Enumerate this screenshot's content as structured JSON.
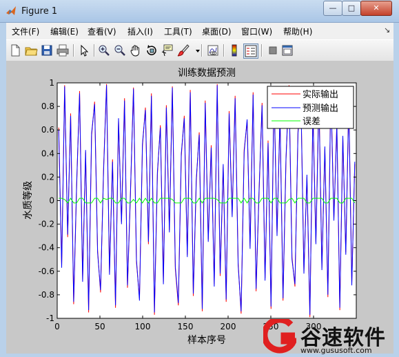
{
  "window": {
    "title": "Figure 1",
    "min_label": "—",
    "max_label": "□",
    "close_label": "✕"
  },
  "menu": [
    "文件(F)",
    "编辑(E)",
    "查看(V)",
    "插入(I)",
    "工具(T)",
    "桌面(D)",
    "窗口(W)",
    "帮助(H)"
  ],
  "menu_overflow_label": "↘",
  "toolbar_icons": [
    "new-figure-icon",
    "open-file-icon",
    "save-icon",
    "print-icon",
    "select-arrow-icon",
    "zoom-in-icon",
    "zoom-out-icon",
    "pan-hand-icon",
    "rotate-3d-icon",
    "data-cursor-icon",
    "brush-icon",
    "brush-dropdown-icon",
    "link-plot-icon",
    "insert-colorbar-icon",
    "insert-legend-icon",
    "hide-plot-tools-icon",
    "show-plot-tools-icon"
  ],
  "colors": {
    "actual": "#ff0000",
    "predicted": "#0000ff",
    "error": "#00ff00",
    "figure_bg": "#c8c8c8",
    "axes_bg": "#ffffff"
  },
  "chart_data": {
    "type": "line",
    "title": "训练数据预测",
    "xlabel": "样本序号",
    "ylabel": "水质等级",
    "xlim": [
      0,
      350
    ],
    "ylim": [
      -1,
      1
    ],
    "xticks": [
      "0",
      "50",
      "100",
      "150",
      "200",
      "250",
      "300"
    ],
    "yticks": [
      "-1",
      "-0.8",
      "-0.6",
      "-0.4",
      "-0.2",
      "0",
      "0.2",
      "0.4",
      "0.6",
      "0.8",
      "1"
    ],
    "legend_position": "top-right",
    "series": [
      {
        "name": "实际输出",
        "color": "#ff0000",
        "values": [
          0.62,
          -0.55,
          0.98,
          -0.31,
          0.74,
          -0.88,
          0.12,
          0.93,
          -0.67,
          0.41,
          -0.95,
          0.55,
          0.84,
          -0.42,
          -0.78,
          0.27,
          0.99,
          -0.61,
          0.35,
          -0.91,
          0.68,
          -0.18,
          0.87,
          -0.74,
          0.05,
          0.96,
          -0.52,
          -0.83,
          0.46,
          0.79,
          -0.37,
          0.91,
          -0.97,
          0.22,
          0.64,
          -0.69,
          0.81,
          -0.25,
          0.97,
          -0.58,
          -0.89,
          0.38,
          0.72,
          -0.46,
          0.94,
          -0.81,
          0.16,
          0.58,
          -0.94,
          0.85,
          -0.33,
          0.47,
          -0.71,
          0.99,
          -0.64,
          0.29,
          -0.86,
          0.76,
          -0.12,
          0.89,
          -0.53,
          -0.96,
          0.43,
          0.67,
          -0.39,
          0.92,
          -0.77,
          0.08,
          0.83,
          -0.66,
          0.51,
          -0.92,
          0.95,
          -0.28,
          0.71,
          -0.85,
          0.34,
          0.98,
          -0.48,
          -0.73,
          0.59,
          0.88,
          -0.6,
          0.2,
          -0.99,
          0.77,
          -0.35,
          0.9,
          -0.57,
          0.44,
          -0.82,
          0.97,
          -0.15,
          0.66,
          -0.93,
          0.53,
          -0.44,
          0.86,
          -0.7,
          0.31
        ]
      },
      {
        "name": "预测输出",
        "color": "#0000ff",
        "values": [
          0.6,
          -0.57,
          0.97,
          -0.29,
          0.72,
          -0.86,
          0.14,
          0.91,
          -0.69,
          0.43,
          -0.93,
          0.57,
          0.82,
          -0.44,
          -0.76,
          0.25,
          0.98,
          -0.63,
          0.33,
          -0.89,
          0.7,
          -0.2,
          0.85,
          -0.72,
          0.07,
          0.95,
          -0.5,
          -0.85,
          0.48,
          0.77,
          -0.35,
          0.89,
          -0.95,
          0.24,
          0.62,
          -0.71,
          0.79,
          -0.27,
          0.96,
          -0.56,
          -0.87,
          0.4,
          0.7,
          -0.48,
          0.92,
          -0.79,
          0.18,
          0.56,
          -0.92,
          0.83,
          -0.35,
          0.45,
          -0.73,
          0.98,
          -0.62,
          0.31,
          -0.84,
          0.74,
          -0.14,
          0.87,
          -0.55,
          -0.94,
          0.41,
          0.69,
          -0.41,
          0.9,
          -0.75,
          0.1,
          0.81,
          -0.68,
          0.49,
          -0.9,
          0.93,
          -0.3,
          0.73,
          -0.83,
          0.36,
          0.97,
          -0.5,
          -0.71,
          0.57,
          0.86,
          -0.62,
          0.22,
          -0.97,
          0.75,
          -0.37,
          0.88,
          -0.59,
          0.46,
          -0.8,
          0.95,
          -0.17,
          0.64,
          -0.91,
          0.55,
          -0.46,
          0.84,
          -0.72,
          0.33
        ]
      },
      {
        "name": "误差",
        "color": "#00ff00",
        "values": [
          0.02,
          0.02,
          0.01,
          -0.02,
          0.02,
          -0.02,
          -0.02,
          0.02,
          0.02,
          -0.02,
          -0.02,
          -0.02,
          0.02,
          0.02,
          -0.02,
          0.02,
          0.01,
          0.02,
          0.02,
          -0.02,
          -0.02,
          0.02,
          0.02,
          -0.02,
          -0.02,
          0.01,
          -0.02,
          0.02,
          -0.02,
          0.02,
          -0.02,
          0.02,
          -0.02,
          -0.02,
          0.02,
          0.02,
          0.02,
          0.02,
          0.01,
          -0.02,
          -0.02,
          -0.02,
          0.02,
          0.02,
          0.02,
          -0.02,
          -0.02,
          0.02,
          -0.02,
          0.02,
          0.02,
          0.02,
          0.02,
          0.01,
          -0.02,
          -0.02,
          -0.02,
          0.02,
          0.02,
          0.02,
          0.02,
          -0.02,
          0.02,
          -0.02,
          0.02,
          0.02,
          -0.02,
          -0.02,
          0.02,
          0.02,
          0.02,
          -0.02,
          0.02,
          0.02,
          -0.02,
          -0.02,
          -0.02,
          0.01,
          0.02,
          -0.02,
          0.02,
          0.02,
          0.02,
          -0.02,
          -0.02,
          0.02,
          0.02,
          0.02,
          0.02,
          -0.02,
          -0.02,
          0.02,
          0.02,
          0.02,
          -0.02,
          -0.02,
          0.02,
          0.02,
          0.02,
          -0.02
        ]
      }
    ]
  },
  "watermark": {
    "name": "谷速软件",
    "url": "www.gususoft.com"
  }
}
